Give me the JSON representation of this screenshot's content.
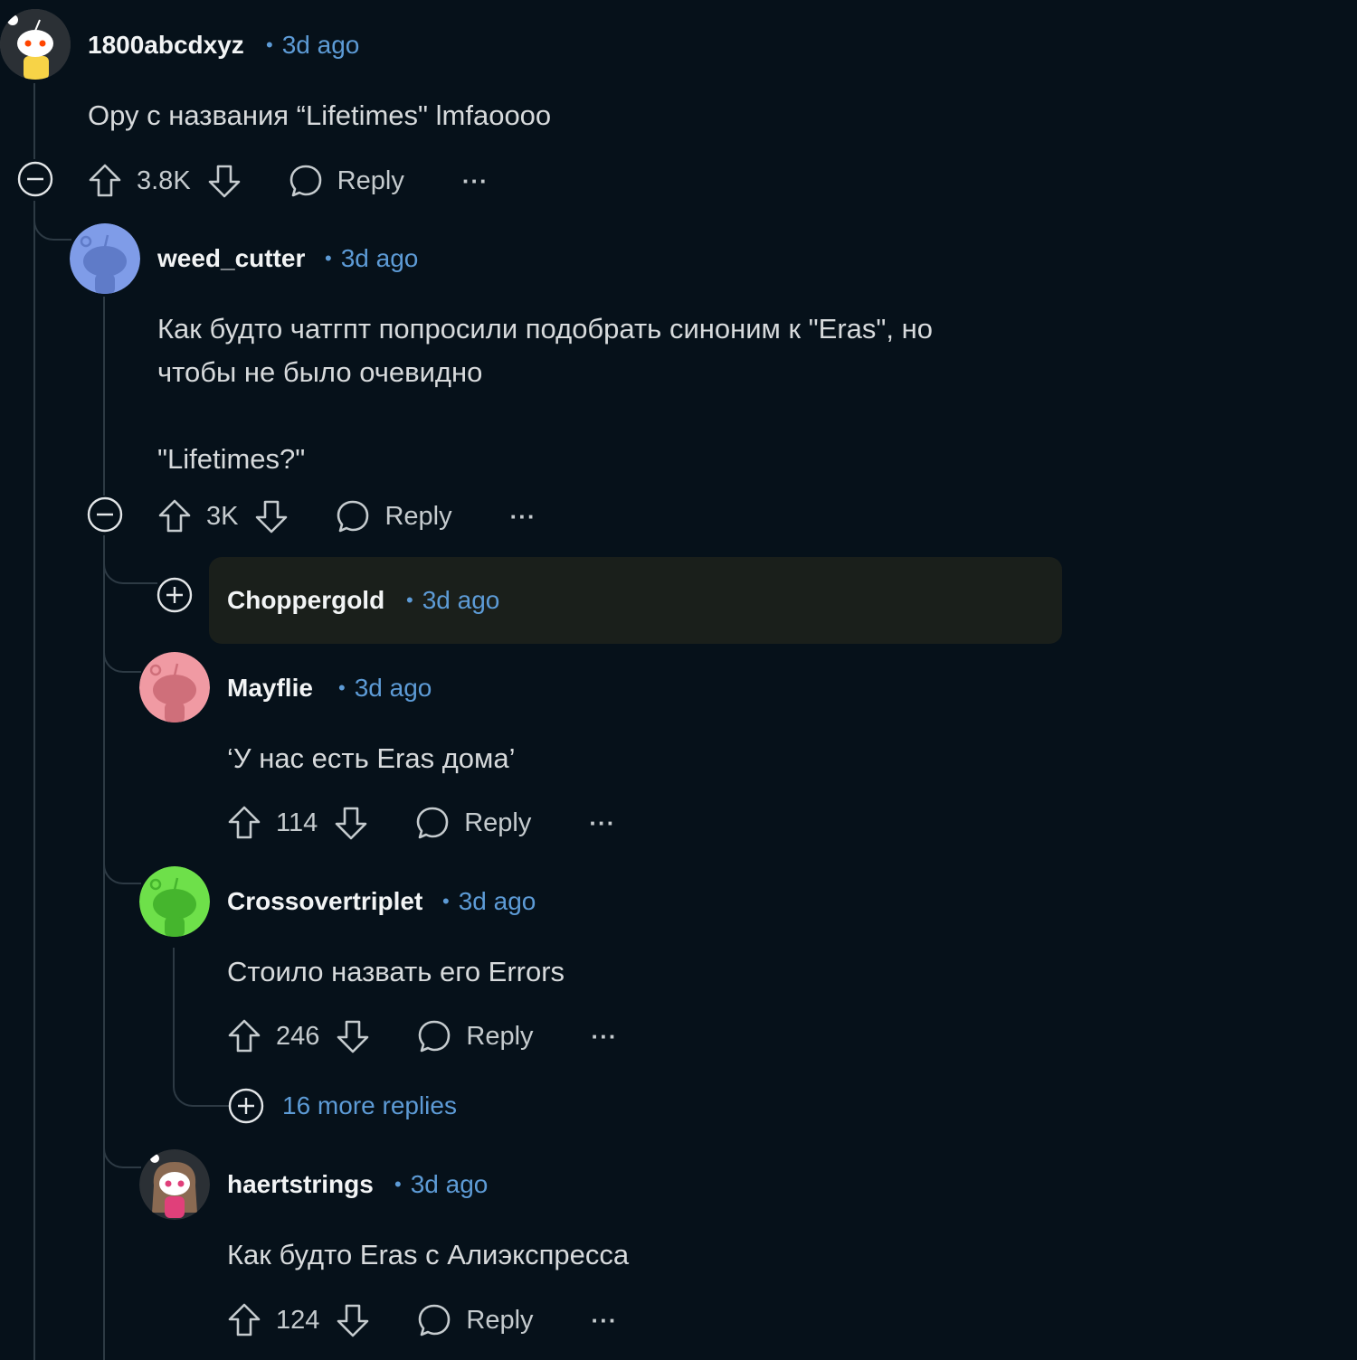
{
  "comments": [
    {
      "user": "1800abcdxyz",
      "time": "3d ago",
      "body": "Ору с названия “Lifetimes\" lmfaoooo",
      "score": "3.8K",
      "reply": "Reply",
      "more": "···"
    },
    {
      "user": "weed_cutter",
      "time": "3d ago",
      "body": "Как будто чатгпт попросили подобрать синоним к \"Eras\", но\nчтобы не было очевидно\n\n\"Lifetimes?\"",
      "score": "3K",
      "reply": "Reply",
      "more": "···"
    },
    {
      "user": "Choppergold",
      "time": "3d ago"
    },
    {
      "user": "Mayflie",
      "time": "3d ago",
      "body": "‘У нас есть Eras дома’",
      "score": "114",
      "reply": "Reply",
      "more": "···"
    },
    {
      "user": "Crossovertriplet",
      "time": "3d ago",
      "body": "Стоило назвать его Errors",
      "score": "246",
      "reply": "Reply",
      "more": "···"
    },
    {
      "user": "haertstrings",
      "time": "3d ago",
      "body": "Как будто Eras с Алиэкспресса",
      "score": "124",
      "reply": "Reply",
      "more": "···"
    }
  ],
  "more_replies": "16 more replies",
  "separator": "•",
  "icons": {
    "upvote": "upvote-icon",
    "downvote": "downvote-icon",
    "reply": "comment-bubble-icon",
    "collapse": "collapse-minus-icon",
    "expand": "expand-plus-icon",
    "overflow": "overflow-dots-icon"
  },
  "colors": {
    "background": "#06111a",
    "link": "#5d9bd6",
    "thread_line": "#2d3a44",
    "collapsed_bg": "#1a1f1b"
  }
}
